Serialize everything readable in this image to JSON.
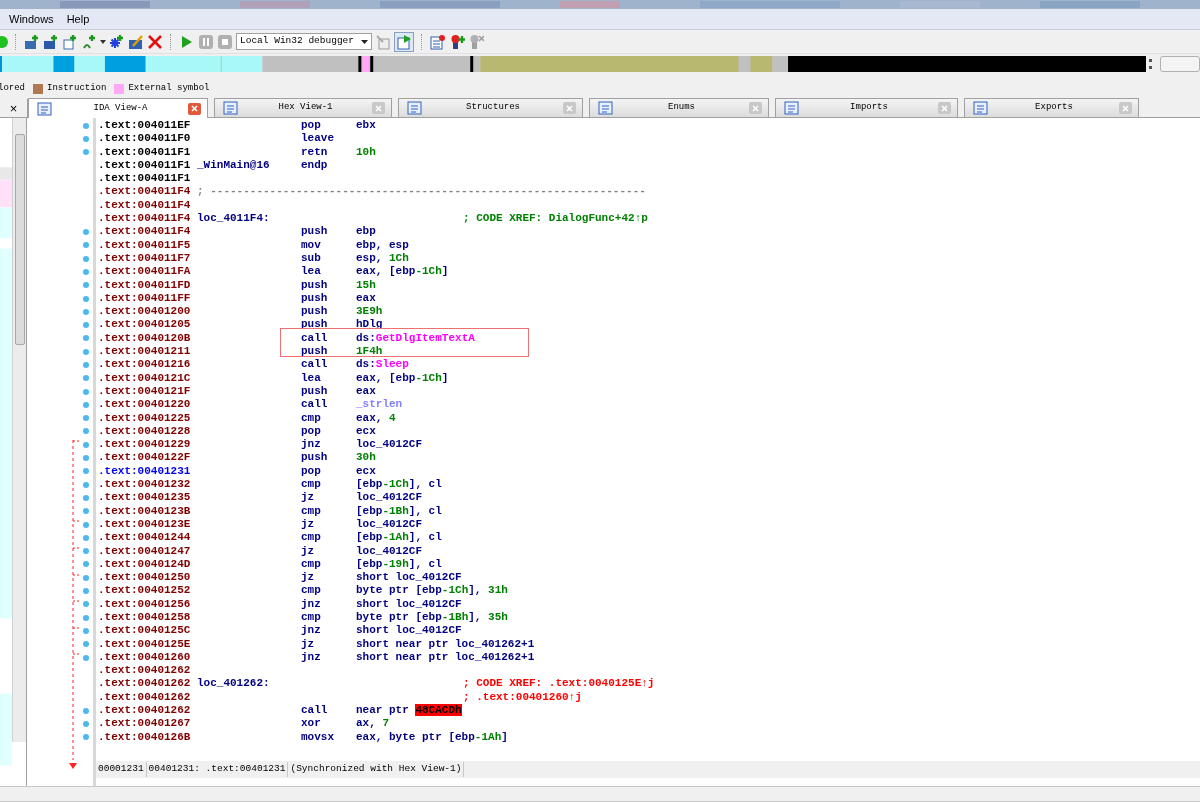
{
  "menu": [
    {
      "label": "Windows"
    },
    {
      "label": "Help"
    }
  ],
  "toolbar": {
    "debugger": "Local Win32 debugger"
  },
  "legend": [
    {
      "label": "lored"
    },
    {
      "label": "Instruction",
      "color": "#b07850"
    },
    {
      "label": "External symbol",
      "color": "#ffa8f8"
    }
  ],
  "left_tab": {
    "close": "×"
  },
  "tabs": [
    {
      "label": "IDA View-A",
      "selected": true
    },
    {
      "label": "Hex View-1",
      "selected": false
    },
    {
      "label": "Structures",
      "selected": false
    },
    {
      "label": "Enums",
      "selected": false
    },
    {
      "label": "Imports",
      "selected": false
    },
    {
      "label": "Exports",
      "selected": false
    }
  ],
  "lines": [
    {
      "addr": ".text:004011EF",
      "kind": "plain",
      "dot": true,
      "mnem": "pop",
      "ops": [
        {
          "t": "ebx",
          "kind": "plain"
        }
      ]
    },
    {
      "addr": ".text:004011F0",
      "kind": "plain",
      "dot": true,
      "mnem": "leave"
    },
    {
      "addr": ".text:004011F1",
      "kind": "plain",
      "dot": true,
      "mnem": "retn",
      "ops": [
        {
          "t": "10h",
          "kind": "num"
        }
      ]
    },
    {
      "addr": ".text:004011F1",
      "kind": "plain",
      "dot": false,
      "label": "_WinMain@16",
      "mnem": "endp"
    },
    {
      "addr": ".text:004011F1",
      "kind": "plain",
      "dot": false
    },
    {
      "addr": ".text:004011F4",
      "kind": "code",
      "dot": false,
      "separator": "; ------------------------------------------------------------------"
    },
    {
      "addr": ".text:004011F4",
      "kind": "code",
      "dot": false
    },
    {
      "addr": ".text:004011F4",
      "kind": "code",
      "dot": false,
      "label": "loc_4011F4:",
      "cmt": {
        "t": "; CODE XREF: DialogFunc+42↑p",
        "kind": "xref"
      }
    },
    {
      "addr": ".text:004011F4",
      "kind": "code",
      "dot": true,
      "mnem": "push",
      "ops": [
        {
          "t": "ebp",
          "kind": "plain"
        }
      ]
    },
    {
      "addr": ".text:004011F5",
      "kind": "code",
      "dot": true,
      "mnem": "mov",
      "ops": [
        {
          "t": "ebp, esp",
          "kind": "plain"
        }
      ]
    },
    {
      "addr": ".text:004011F7",
      "kind": "code",
      "dot": true,
      "mnem": "sub",
      "ops": [
        {
          "t": "esp, ",
          "kind": "plain"
        },
        {
          "t": "1Ch",
          "kind": "num"
        }
      ]
    },
    {
      "addr": ".text:004011FA",
      "kind": "code",
      "dot": true,
      "mnem": "lea",
      "ops": [
        {
          "t": "eax, [ebp",
          "kind": "plain"
        },
        {
          "t": "-1Ch",
          "kind": "num"
        },
        {
          "t": "]",
          "kind": "plain"
        }
      ]
    },
    {
      "addr": ".text:004011FD",
      "kind": "code",
      "dot": true,
      "mnem": "push",
      "ops": [
        {
          "t": "15h",
          "kind": "num"
        }
      ]
    },
    {
      "addr": ".text:004011FF",
      "kind": "code",
      "dot": true,
      "mnem": "push",
      "ops": [
        {
          "t": "eax",
          "kind": "plain"
        }
      ]
    },
    {
      "addr": ".text:00401200",
      "kind": "code",
      "dot": true,
      "mnem": "push",
      "ops": [
        {
          "t": "3E9h",
          "kind": "num"
        }
      ]
    },
    {
      "addr": ".text:00401205",
      "kind": "code",
      "dot": true,
      "mnem": "push",
      "ops": [
        {
          "t": "hDlg",
          "kind": "plain"
        }
      ]
    },
    {
      "addr": ".text:0040120B",
      "kind": "code",
      "dot": true,
      "mnem": "call",
      "ops": [
        {
          "t": "ds:",
          "kind": "plain"
        },
        {
          "t": "GetDlgItemTextA",
          "kind": "import"
        }
      ]
    },
    {
      "addr": ".text:00401211",
      "kind": "code",
      "dot": true,
      "mnem": "push",
      "ops": [
        {
          "t": "1F4h",
          "kind": "num"
        }
      ]
    },
    {
      "addr": ".text:00401216",
      "kind": "code",
      "dot": true,
      "mnem": "call",
      "ops": [
        {
          "t": "ds:",
          "kind": "plain"
        },
        {
          "t": "Sleep",
          "kind": "import"
        }
      ]
    },
    {
      "addr": ".text:0040121C",
      "kind": "code",
      "dot": true,
      "mnem": "lea",
      "ops": [
        {
          "t": "eax, [ebp",
          "kind": "plain"
        },
        {
          "t": "-1Ch",
          "kind": "num"
        },
        {
          "t": "]",
          "kind": "plain"
        }
      ]
    },
    {
      "addr": ".text:0040121F",
      "kind": "code",
      "dot": true,
      "mnem": "push",
      "ops": [
        {
          "t": "eax",
          "kind": "plain"
        }
      ]
    },
    {
      "addr": ".text:00401220",
      "kind": "code",
      "dot": true,
      "mnem": "call",
      "ops": [
        {
          "t": "_strlen",
          "kind": "lib"
        }
      ]
    },
    {
      "addr": ".text:00401225",
      "kind": "code",
      "dot": true,
      "mnem": "cmp",
      "ops": [
        {
          "t": "eax, ",
          "kind": "plain"
        },
        {
          "t": "4",
          "kind": "num"
        }
      ]
    },
    {
      "addr": ".text:00401228",
      "kind": "code",
      "dot": true,
      "mnem": "pop",
      "ops": [
        {
          "t": "ecx",
          "kind": "plain"
        }
      ]
    },
    {
      "addr": ".text:00401229",
      "kind": "code",
      "dot": true,
      "mnem": "jnz",
      "ops": [
        {
          "t": "loc_4012CF",
          "kind": "plain"
        }
      ]
    },
    {
      "addr": ".text:0040122F",
      "kind": "code",
      "dot": true,
      "mnem": "push",
      "ops": [
        {
          "t": "30h",
          "kind": "num"
        }
      ]
    },
    {
      "addr": ".text:00401231",
      "kind": "current",
      "dot": true,
      "mnem": "pop",
      "ops": [
        {
          "t": "ecx",
          "kind": "plain"
        }
      ]
    },
    {
      "addr": ".text:00401232",
      "kind": "code",
      "dot": true,
      "mnem": "cmp",
      "ops": [
        {
          "t": "[ebp",
          "kind": "plain"
        },
        {
          "t": "-1Ch",
          "kind": "num"
        },
        {
          "t": "], cl",
          "kind": "plain"
        }
      ]
    },
    {
      "addr": ".text:00401235",
      "kind": "code",
      "dot": true,
      "mnem": "jz",
      "ops": [
        {
          "t": "loc_4012CF",
          "kind": "plain"
        }
      ]
    },
    {
      "addr": ".text:0040123B",
      "kind": "code",
      "dot": true,
      "mnem": "cmp",
      "ops": [
        {
          "t": "[ebp",
          "kind": "plain"
        },
        {
          "t": "-1Bh",
          "kind": "num"
        },
        {
          "t": "], cl",
          "kind": "plain"
        }
      ]
    },
    {
      "addr": ".text:0040123E",
      "kind": "code",
      "dot": true,
      "mnem": "jz",
      "ops": [
        {
          "t": "loc_4012CF",
          "kind": "plain"
        }
      ]
    },
    {
      "addr": ".text:00401244",
      "kind": "code",
      "dot": true,
      "mnem": "cmp",
      "ops": [
        {
          "t": "[ebp",
          "kind": "plain"
        },
        {
          "t": "-1Ah",
          "kind": "num"
        },
        {
          "t": "], cl",
          "kind": "plain"
        }
      ]
    },
    {
      "addr": ".text:00401247",
      "kind": "code",
      "dot": true,
      "mnem": "jz",
      "ops": [
        {
          "t": "loc_4012CF",
          "kind": "plain"
        }
      ]
    },
    {
      "addr": ".text:0040124D",
      "kind": "code",
      "dot": true,
      "mnem": "cmp",
      "ops": [
        {
          "t": "[ebp",
          "kind": "plain"
        },
        {
          "t": "-19h",
          "kind": "num"
        },
        {
          "t": "], cl",
          "kind": "plain"
        }
      ]
    },
    {
      "addr": ".text:00401250",
      "kind": "code",
      "dot": true,
      "mnem": "jz",
      "ops": [
        {
          "t": "short loc_4012CF",
          "kind": "plain"
        }
      ]
    },
    {
      "addr": ".text:00401252",
      "kind": "code",
      "dot": true,
      "mnem": "cmp",
      "ops": [
        {
          "t": "byte ptr [ebp",
          "kind": "plain"
        },
        {
          "t": "-1Ch",
          "kind": "num"
        },
        {
          "t": "], ",
          "kind": "plain"
        },
        {
          "t": "31h",
          "kind": "num"
        }
      ]
    },
    {
      "addr": ".text:00401256",
      "kind": "code",
      "dot": true,
      "mnem": "jnz",
      "ops": [
        {
          "t": "short loc_4012CF",
          "kind": "plain"
        }
      ]
    },
    {
      "addr": ".text:00401258",
      "kind": "code",
      "dot": true,
      "mnem": "cmp",
      "ops": [
        {
          "t": "byte ptr [ebp",
          "kind": "plain"
        },
        {
          "t": "-1Bh",
          "kind": "num"
        },
        {
          "t": "], ",
          "kind": "plain"
        },
        {
          "t": "35h",
          "kind": "num"
        }
      ]
    },
    {
      "addr": ".text:0040125C",
      "kind": "code",
      "dot": true,
      "mnem": "jnz",
      "ops": [
        {
          "t": "short loc_4012CF",
          "kind": "plain"
        }
      ]
    },
    {
      "addr": ".text:0040125E",
      "kind": "code",
      "dot": true,
      "mnem": "jz",
      "ops": [
        {
          "t": "short near ptr loc_401262+1",
          "kind": "plain"
        }
      ]
    },
    {
      "addr": ".text:00401260",
      "kind": "code",
      "dot": true,
      "mnem": "jnz",
      "ops": [
        {
          "t": "short near ptr loc_401262+1",
          "kind": "plain"
        }
      ]
    },
    {
      "addr": ".text:00401262",
      "kind": "code",
      "dot": false
    },
    {
      "addr": ".text:00401262",
      "kind": "code",
      "dot": false,
      "label": "loc_401262:",
      "cmt": {
        "t": "; CODE XREF: .text:0040125E↑j",
        "kind": "bad"
      }
    },
    {
      "addr": ".text:00401262",
      "kind": "code",
      "dot": false,
      "cmt": {
        "t": "; .text:00401260↑j",
        "kind": "bad"
      }
    },
    {
      "addr": ".text:00401262",
      "kind": "code",
      "dot": true,
      "mnem": "call",
      "ops": [
        {
          "t": "near ptr ",
          "kind": "plain"
        },
        {
          "t": "48CACDh",
          "kind": "error"
        }
      ]
    },
    {
      "addr": ".text:00401267",
      "kind": "code",
      "dot": true,
      "mnem": "xor",
      "ops": [
        {
          "t": "ax, ",
          "kind": "plain"
        },
        {
          "t": "7",
          "kind": "num"
        }
      ]
    },
    {
      "addr": ".text:0040126B",
      "kind": "code",
      "dot": true,
      "mnem": "movsx",
      "ops": [
        {
          "t": "eax, byte ptr [ebp",
          "kind": "plain"
        },
        {
          "t": "-1Ah",
          "kind": "num"
        },
        {
          "t": "]",
          "kind": "plain"
        }
      ]
    }
  ],
  "status_line": [
    "00001231",
    "00401231: .text:00401231",
    "(Synchronized with Hex View-1)"
  ]
}
